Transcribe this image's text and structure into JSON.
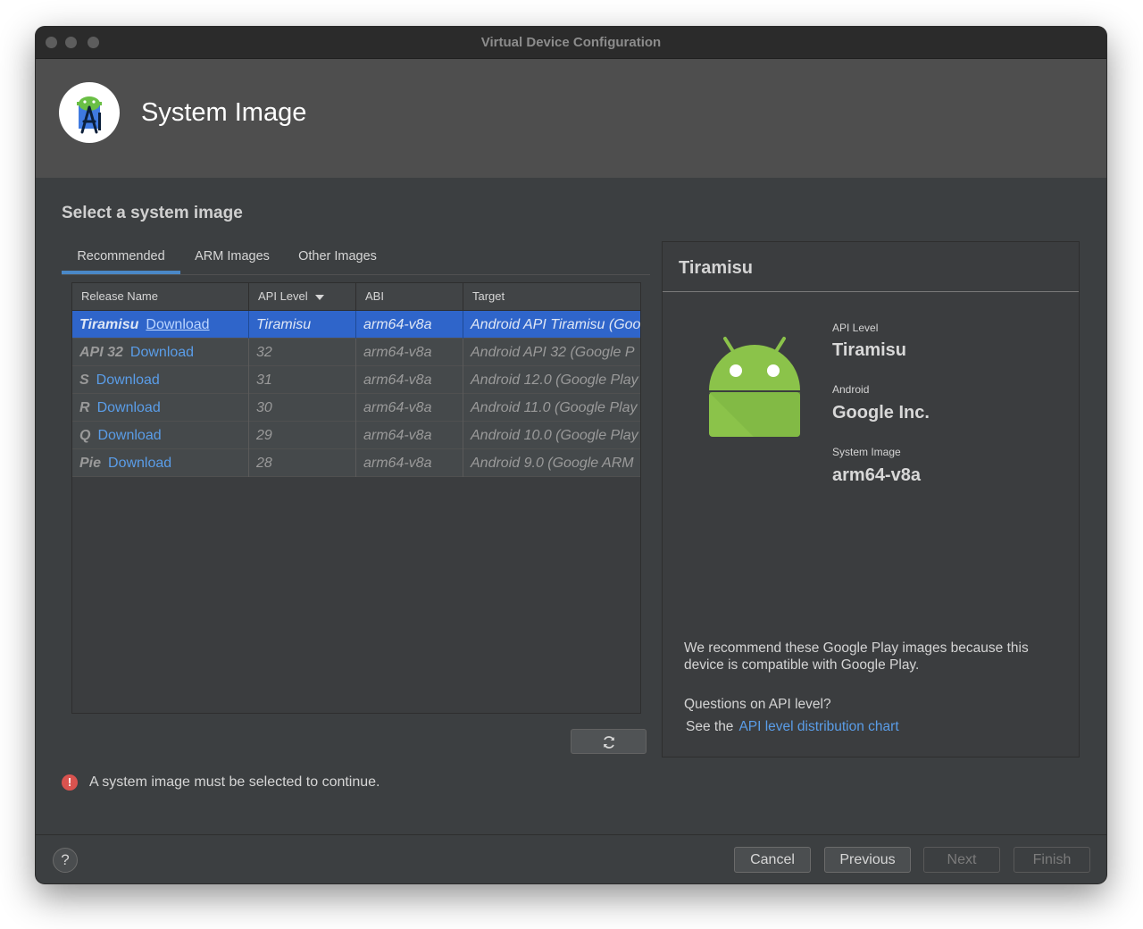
{
  "window": {
    "title": "Virtual Device Configuration"
  },
  "header": {
    "title": "System Image",
    "logo_icon": "android-studio-icon"
  },
  "section_title": "Select a system image",
  "tabs": [
    {
      "label": "Recommended",
      "active": true
    },
    {
      "label": "ARM Images",
      "active": false
    },
    {
      "label": "Other Images",
      "active": false
    }
  ],
  "table": {
    "columns": [
      "Release Name",
      "API Level",
      "ABI",
      "Target"
    ],
    "sort_column": "API Level",
    "rows": [
      {
        "release": "Tiramisu",
        "download": "Download",
        "api": "Tiramisu",
        "abi": "arm64-v8a",
        "target": "Android API Tiramisu (Goo",
        "selected": true
      },
      {
        "release": "API 32",
        "download": "Download",
        "api": "32",
        "abi": "arm64-v8a",
        "target": "Android API 32 (Google P",
        "selected": false
      },
      {
        "release": "S",
        "download": "Download",
        "api": "31",
        "abi": "arm64-v8a",
        "target": "Android 12.0 (Google Play",
        "selected": false
      },
      {
        "release": "R",
        "download": "Download",
        "api": "30",
        "abi": "arm64-v8a",
        "target": "Android 11.0 (Google Play",
        "selected": false
      },
      {
        "release": "Q",
        "download": "Download",
        "api": "29",
        "abi": "arm64-v8a",
        "target": "Android 10.0 (Google Play",
        "selected": false
      },
      {
        "release": "Pie",
        "download": "Download",
        "api": "28",
        "abi": "arm64-v8a",
        "target": "Android 9.0 (Google ARM",
        "selected": false
      }
    ]
  },
  "refresh_icon": "refresh-icon",
  "error": {
    "icon": "error-icon",
    "message": "A system image must be selected to continue."
  },
  "details": {
    "title": "Tiramisu",
    "image_icon": "android-robot-icon",
    "api_level_label": "API Level",
    "api_level_value": "Tiramisu",
    "android_label": "Android",
    "android_value": "Google Inc.",
    "system_image_label": "System Image",
    "system_image_value": "arm64-v8a",
    "recommend_text": "We recommend these Google Play images because this device is compatible with Google Play.",
    "questions_text": "Questions on API level?",
    "see_the_text": "See the",
    "chart_link": "API level distribution chart"
  },
  "footer": {
    "help_label": "?",
    "cancel": "Cancel",
    "previous": "Previous",
    "next": "Next",
    "finish": "Finish"
  },
  "colors": {
    "accent": "#4a88c7",
    "selection": "#2f65ca",
    "link": "#5a9de8",
    "error": "#d9534f",
    "android_green": "#8bc34a"
  }
}
